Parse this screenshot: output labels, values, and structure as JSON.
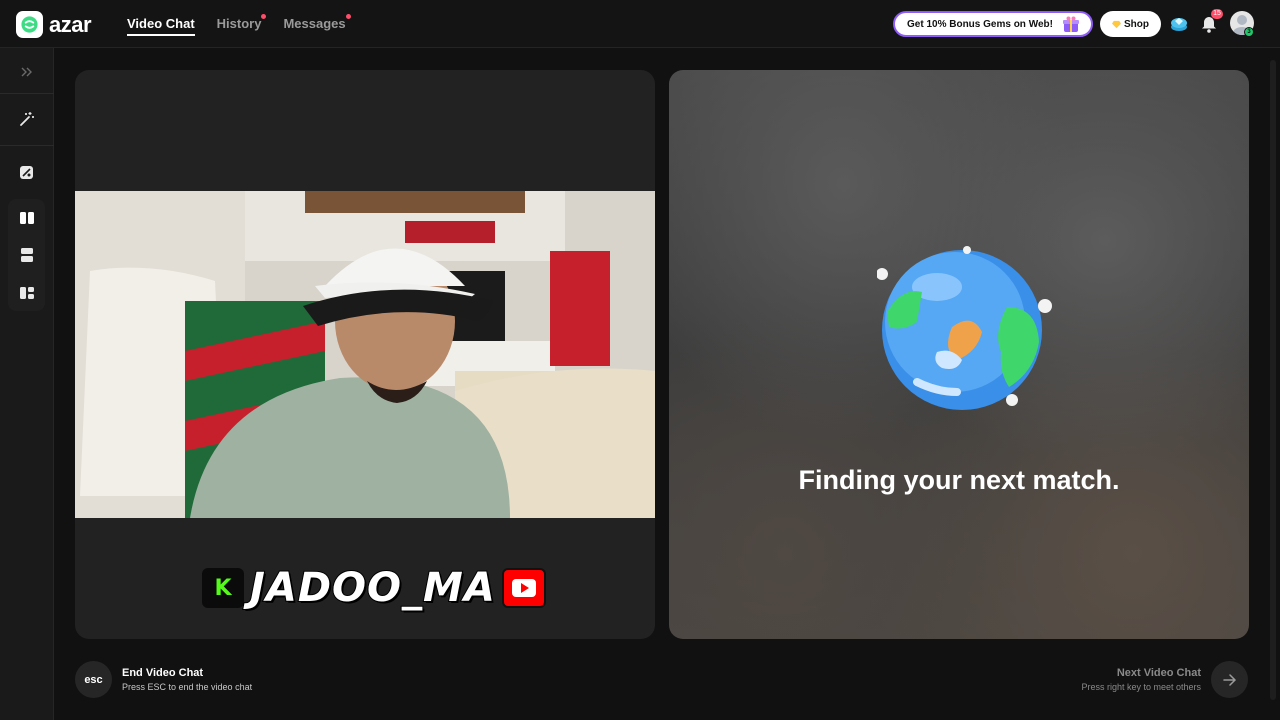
{
  "app": {
    "name": "azar"
  },
  "nav": {
    "items": [
      {
        "label": "Video Chat",
        "active": true,
        "dot": false
      },
      {
        "label": "History",
        "active": false,
        "dot": true
      },
      {
        "label": "Messages",
        "active": false,
        "dot": true
      }
    ]
  },
  "header": {
    "promo_label": "Get 10% Bonus Gems on Web!",
    "shop_label": "Shop",
    "notification_count": "15",
    "profile_level": "3"
  },
  "sidebar": {
    "icons": [
      "expand-chevrons-icon",
      "magic-wand-icon",
      "filter-icon",
      "layout-side-by-side-icon",
      "layout-stacked-icon",
      "layout-grid-icon"
    ]
  },
  "left_panel": {
    "streamer_name": "JADOO_MA",
    "kick_letter": "K"
  },
  "right_panel": {
    "status_text": "Finding your next match."
  },
  "footer": {
    "esc_key": "esc",
    "end_title": "End Video Chat",
    "end_sub": "Press ESC to end the video chat",
    "next_title": "Next Video Chat",
    "next_sub": "Press right key to meet others"
  },
  "colors": {
    "accent_green": "#3ddc84",
    "notification_red": "#ff4d6a",
    "promo_border": "#8e5cf6"
  }
}
